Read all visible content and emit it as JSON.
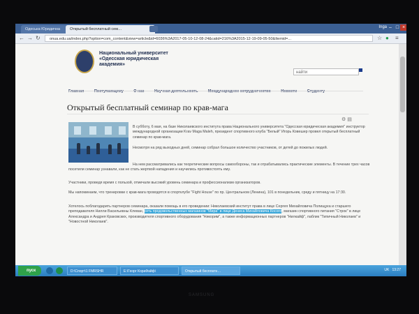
{
  "browser": {
    "tabs": [
      {
        "label": "Одеська Юридична"
      },
      {
        "label": "Открытый бесплатный сем…"
      }
    ],
    "user_badge": "Inga",
    "url": "onua.edu.ua/index.php?option=com_content&view=article&id=6036%3A2017-05-10-12-08-24&catid=216%3A2015-12-19-09-05-50&Itemid=..."
  },
  "site": {
    "university_name": "Национальный университет\n«Одесская юридическая\nакадемия»",
    "search_placeholder": "найти",
    "nav": [
      "Главная",
      "Поступающему",
      "О нас",
      "Научная деятельность",
      "Международное сотрудничество",
      "Новости",
      "Студенту"
    ]
  },
  "article": {
    "title": "Открытый бесплатный семинар по крав-мага",
    "p1": "В субботу, 6 мая, на базе Николаевского института права Национального университета \"Одесская юридическая академия\" инструктор международной организации Krav Maga Maleh, президент спортивного клуба \"Белый\" Игорь Ковешер провел открытый бесплатный семинар по крав-мага.",
    "p2": "Несмотря на ряд выходных дней, семинар собрал большое количество участников, от детей до пожилых людей.",
    "p3": "На нем рассматривались как теоретические вопросы самообороны, так и отрабатывались практические элементы. В течение трех часов посетили семинар узнавали, как не стать жертвой нападения и научились противостоять ему.",
    "p4": "Участники, проведя время с пользой, отмечали высокий уровень семинара и профессионализм организаторов.",
    "p5": "Мы напоминаем, что тренировки с крав-мага проводятся в спортклубе \"Fight House\" по пр. Центральном (Ленина), 101 в понедельник, среду и пятницу на 17:30.",
    "p6_before": "Хотелось поблагодарить партнеров семинара, оказали помощь в его проведении: Николаевский институт права в лице Сергея Михайловича Полищука и старшего преподавателя Нилли Васильевны Клеван, ",
    "p6_highlight": "сеть продовольственных магазинов \"Мира\" в лице Дениса Михайловича Косого",
    "p6_after": ", магазин спортивного питания \"Строк\" в лице Александра и Андрея Краковских, производителя спортивного оборудования \"Никорим\", а также информационных партнеров \"Нилкайф\", паблик \"Типичный Николаев\" и \"Новостной Николаев\"."
  },
  "taskbar": {
    "start": "пуск",
    "tasks": [
      "D:\\Спорт\\1 FMRSHR",
      "E:\\Георг КораФайф\\",
      "Открытый бесплатн…"
    ],
    "lang": "UK",
    "clock": "13:27"
  },
  "bezel": {
    "brand": "SAMSUNG"
  }
}
